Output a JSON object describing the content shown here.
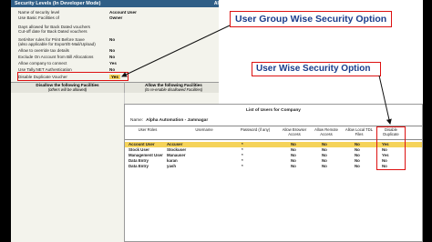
{
  "security_panel": {
    "header": "Security Levels (In Developer Mode)",
    "header_right": "Alph",
    "rows": [
      {
        "label": "Name of security level",
        "value": "Account User"
      },
      {
        "label": "Use Basic Facilities of",
        "value": "Owner"
      },
      {
        "label": "Days allowed for Back Dated vouchers",
        "value": ""
      },
      {
        "label": "Cut-off date for Back Dated vouchers",
        "value": ""
      },
      {
        "label": "Set/Alter rules for Print Before Save",
        "value": "No"
      },
      {
        "label": "(also applicable for Export/E-Mail/Upload)",
        "value": ""
      },
      {
        "label": "Allow to override tax details",
        "value": "No"
      },
      {
        "label": "Exclude On Account from Bill Allocations",
        "value": "No"
      },
      {
        "label": "Allow company to connect",
        "value": "Yes"
      },
      {
        "label": "Use Tally.NET Authentication",
        "value": "No"
      }
    ],
    "dup_label": "Disable Duplicate Voucher",
    "dup_value": "Yes",
    "disallow_title": "Disallow the following Facilities",
    "disallow_sub": "(others will be allowed)",
    "allow_title": "Allow the following Facilities",
    "allow_sub": "(to re-enable disallowed Facilities)"
  },
  "callouts": {
    "group": "User Group Wise Security Option",
    "user": "User Wise Security Option"
  },
  "users_window": {
    "title": "List of Users for Company",
    "name_label": "Name:",
    "company": "Alpha Automation - Jamnagar",
    "columns": [
      "User Roles",
      "Username",
      "Password (if any)",
      "Allow Browser Access",
      "Allow Remote Access",
      "Allow Local TDL Files",
      "Disable Duplicate"
    ],
    "rows": [
      {
        "role": "Account User",
        "username": "Accuser",
        "password": "*",
        "dup": "Yes"
      },
      {
        "role": "Stock User",
        "username": "Stockuser",
        "password": "*",
        "dup": "No"
      },
      {
        "role": "Management User",
        "username": "Manauser",
        "password": "*",
        "dup": "Yes"
      },
      {
        "role": "Data Entry",
        "username": "karan",
        "password": "*",
        "dup": "No"
      },
      {
        "role": "Data Entry",
        "username": "yash",
        "password": "*",
        "dup": "No"
      }
    ],
    "flag_no": "No"
  }
}
